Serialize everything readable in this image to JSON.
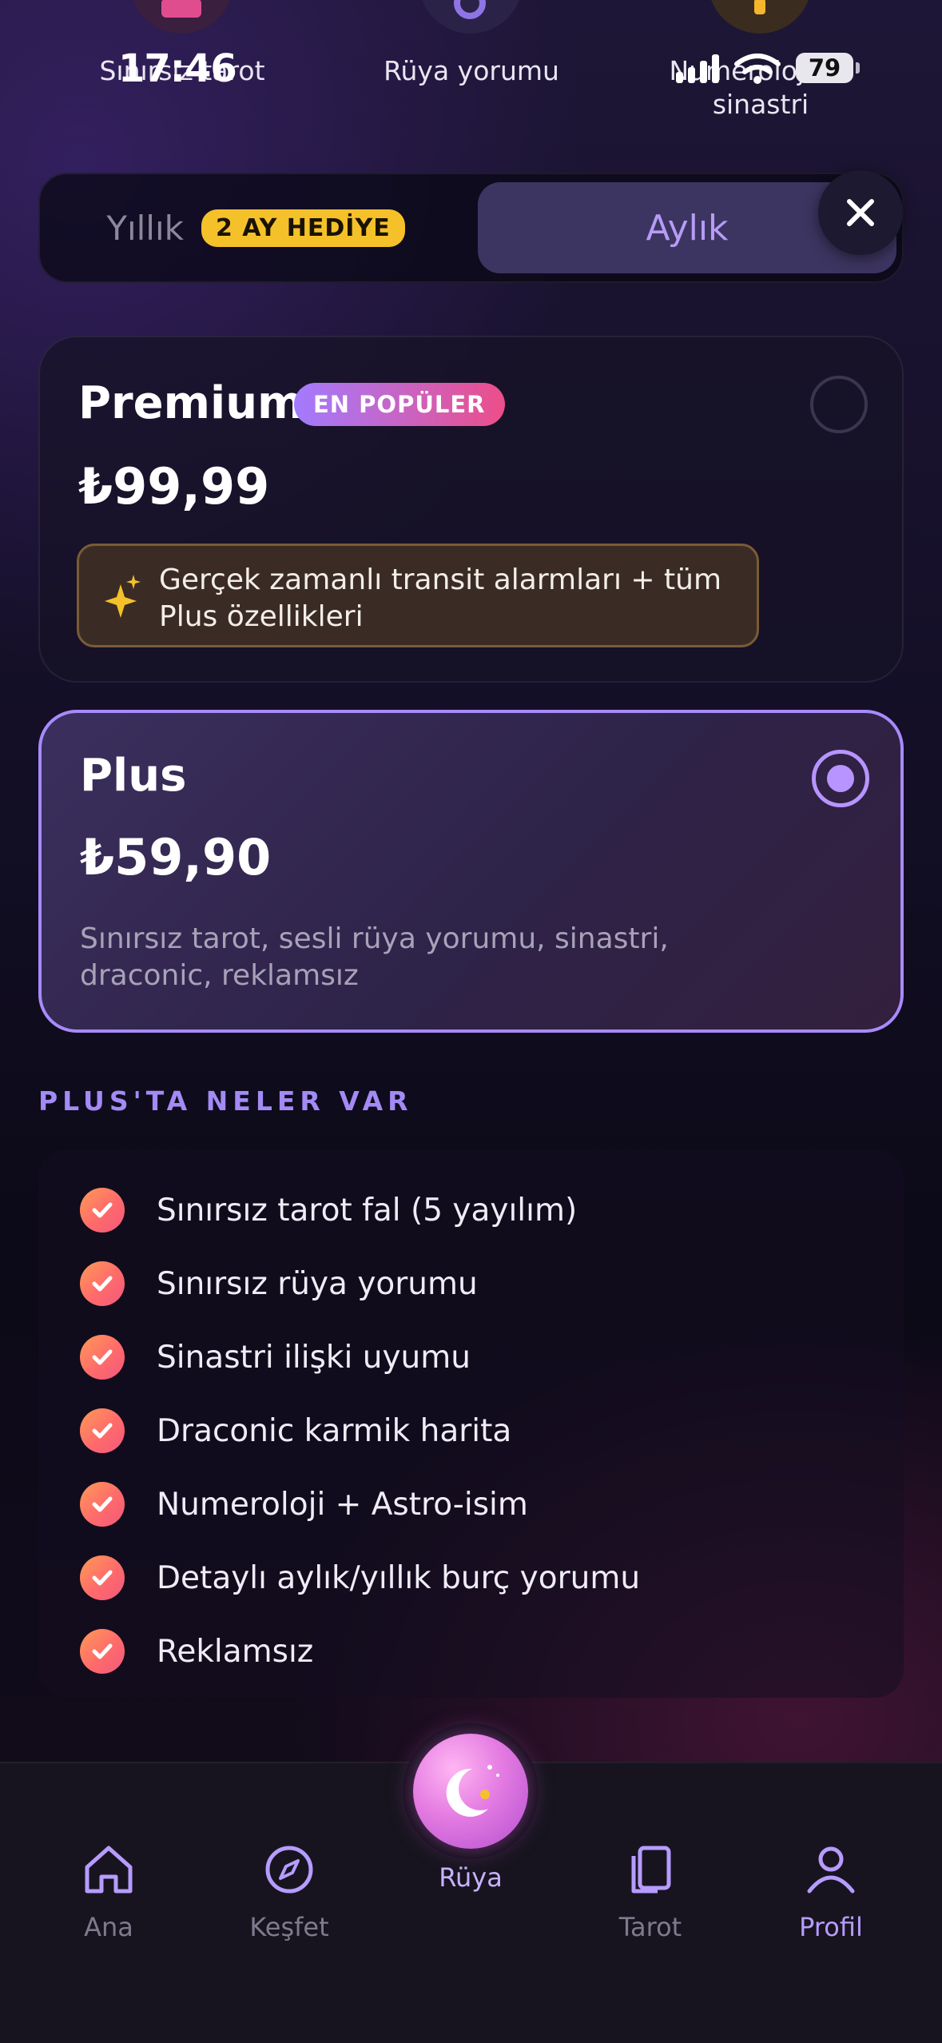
{
  "top_categories": [
    {
      "label": "Sınırsız tarot",
      "icon": "tarot-icon",
      "color": "#c43c7d"
    },
    {
      "label": "Rüya yorumu",
      "icon": "moon-icon",
      "color": "#5b3f9a"
    },
    {
      "label": "Numeroloji ve sinastri",
      "icon": "star-icon",
      "color": "#6b4a1c"
    }
  ],
  "status_bar": {
    "time": "17:46",
    "battery": "79"
  },
  "billing_toggle": {
    "yearly_label": "Yıllık",
    "yearly_badge": "2 AY HEDİYE",
    "monthly_label": "Aylık",
    "selected": "monthly"
  },
  "plans": {
    "premium": {
      "name": "Premium",
      "badge": "EN POPÜLER",
      "price": "₺99,99",
      "highlight": "Gerçek zamanlı transit alarmları + tüm Plus özellikleri",
      "selected": false
    },
    "plus": {
      "name": "Plus",
      "price": "₺59,90",
      "description": "Sınırsız tarot, sesli rüya yorumu, sinastri, draconic, reklamsız",
      "selected": true
    }
  },
  "features": {
    "title": "PLUS'TA NELER VAR",
    "items": [
      "Sınırsız tarot fal (5 yayılım)",
      "Sınırsız rüya yorumu",
      "Sinastri ilişki uyumu",
      "Draconic karmik harita",
      "Numeroloji + Astro-isim",
      "Detaylı aylık/yıllık burç yorumu",
      "Reklamsız"
    ]
  },
  "bottom_nav": {
    "items": [
      {
        "label": "Ana",
        "icon": "home-icon",
        "active": false
      },
      {
        "label": "Keşfet",
        "icon": "compass-icon",
        "active": false
      },
      {
        "label": "Rüya",
        "icon": "moon-orb-icon",
        "active": false
      },
      {
        "label": "Tarot",
        "icon": "cards-icon",
        "active": false
      },
      {
        "label": "Profil",
        "icon": "profile-icon",
        "active": true
      }
    ]
  },
  "colors": {
    "accent_purple": "#a78bfa",
    "gift_badge": "#f5c12a",
    "check_gradient_start": "#ff9a56",
    "check_gradient_end": "#f2587d"
  }
}
